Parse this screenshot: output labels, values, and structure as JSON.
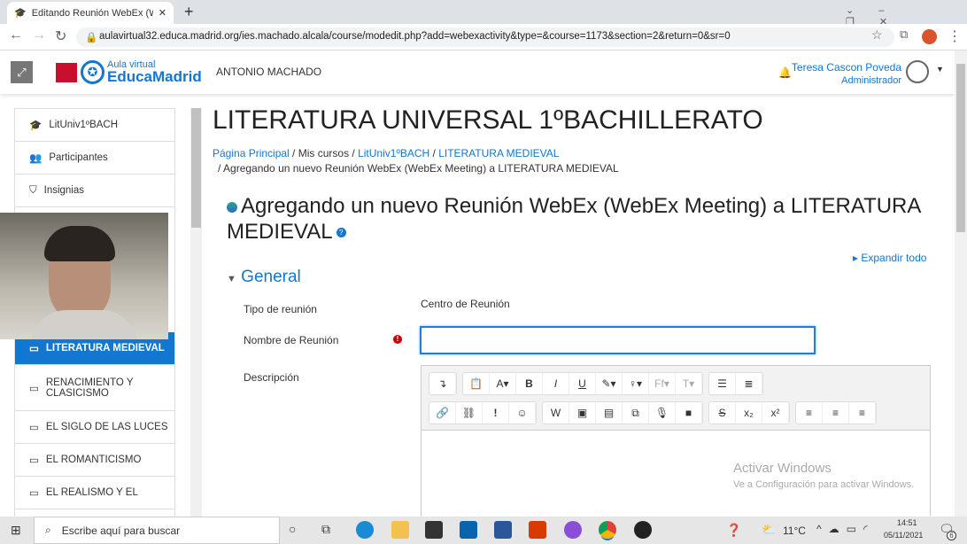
{
  "browser": {
    "tab_title": "Editando Reunión WebEx (WebEx Meeting)",
    "url": "aulavirtual32.educa.madrid.org/ies.machado.alcala/course/modedit.php?add=webexactivity&type=&course=1173&section=2&return=0&sr=0"
  },
  "header": {
    "logo_top": "Aula virtual",
    "logo_bottom": "EducaMadrid",
    "site": "ANTONIO MACHADO",
    "user": "Teresa Cascon Poveda",
    "role": "Administrador"
  },
  "sidebar": {
    "items": [
      {
        "label": "LitUniv1ºBACH"
      },
      {
        "label": "Participantes"
      },
      {
        "label": "Insignias"
      },
      {
        "label": "LITERATURA MEDIEVAL"
      },
      {
        "label": "RENACIMIENTO Y CLASICISMO"
      },
      {
        "label": "EL SIGLO DE LAS LUCES"
      },
      {
        "label": "EL ROMANTICISMO"
      },
      {
        "label": "EL REALISMO Y EL"
      }
    ]
  },
  "main": {
    "course_title": "LITERATURA UNIVERSAL 1ºBACHILLERATO",
    "breadcrumb": [
      "Página Principal",
      "Mis cursos",
      "LitUniv1ºBACH",
      "LITERATURA MEDIEVAL",
      "Agregando un nuevo Reunión WebEx (WebEx Meeting) a LITERATURA MEDIEVAL"
    ],
    "heading": "Agregando un nuevo Reunión WebEx (WebEx Meeting) a LITERATURA MEDIEVAL",
    "expand_all": "Expandir todo",
    "section": "General",
    "fields": {
      "tipo_label": "Tipo de reunión",
      "tipo_value": "Centro de Reunión",
      "nombre_label": "Nombre de Reunión",
      "nombre_value": "",
      "desc_label": "Descripción"
    }
  },
  "watermark": {
    "line1": "Activar Windows",
    "line2": "Ve a Configuración para activar Windows."
  },
  "taskbar": {
    "search_placeholder": "Escribe aquí para buscar",
    "weather": "11°C",
    "time": "14:51",
    "date": "05/11/2021",
    "notifications": "6"
  }
}
